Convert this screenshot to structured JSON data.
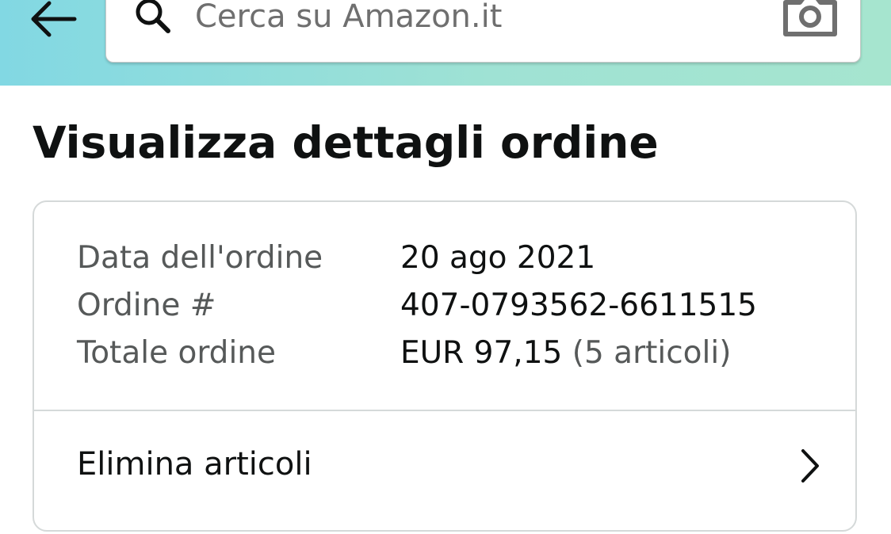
{
  "header": {
    "search": {
      "placeholder": "Cerca su Amazon.it"
    },
    "colors": {
      "gradient_start": "#82d8e3",
      "gradient_end": "#a6e5cf"
    },
    "icons": [
      "back-arrow-icon",
      "search-icon",
      "camera-icon"
    ]
  },
  "page": {
    "title": "Visualizza dettagli ordine"
  },
  "order": {
    "rows": [
      {
        "label": "Data dell'ordine",
        "value": "20 ago 2021"
      },
      {
        "label": "Ordine #",
        "value": "407-0793562-6611515"
      },
      {
        "label": "Totale ordine",
        "value": "EUR 97,15",
        "note": "(5 articoli)"
      }
    ]
  },
  "actions": {
    "remove_items_label": "Elimina articoli",
    "chevron_icon": "chevron-right-icon"
  }
}
